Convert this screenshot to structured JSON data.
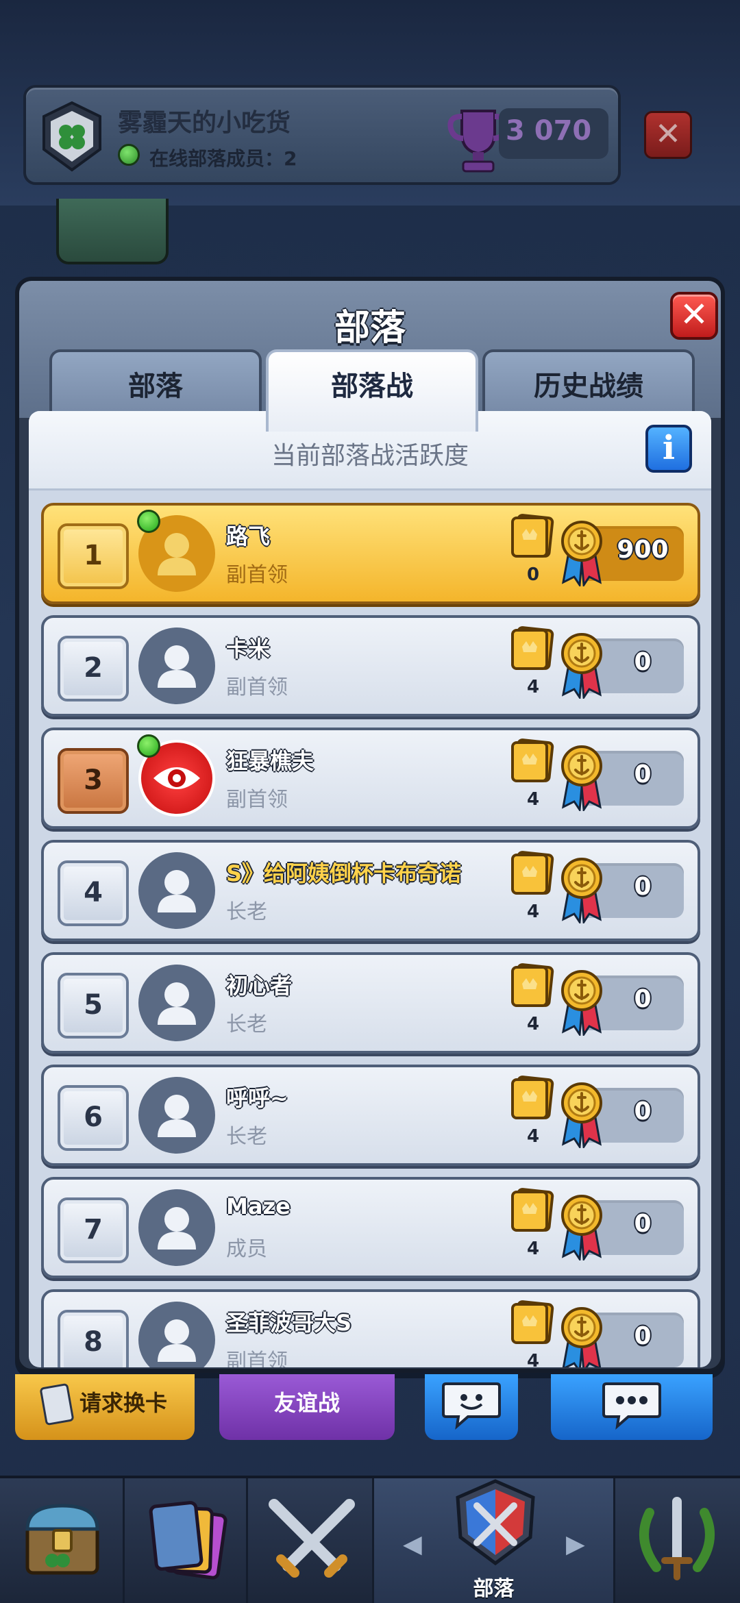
{
  "clan": {
    "name": "雾霾天的小吃货",
    "online_label": "在线部落成员：2",
    "trophies": "3 070"
  },
  "panel": {
    "title": "部落",
    "tabs": [
      {
        "label": "部落",
        "active": false
      },
      {
        "label": "部落战",
        "active": true
      },
      {
        "label": "历史战绩",
        "active": false
      }
    ],
    "activity_title": "当前部落战活跃度",
    "info_label": "i"
  },
  "members": [
    {
      "rank": "1",
      "name": "路飞",
      "role": "副首领",
      "cards": "0",
      "score": "900",
      "online": true,
      "avatar": "gold-silhouette"
    },
    {
      "rank": "2",
      "name": "卡米",
      "role": "副首领",
      "cards": "4",
      "score": "0",
      "online": false,
      "avatar": "silhouette"
    },
    {
      "rank": "3",
      "name": "狂暴樵夫",
      "role": "副首领",
      "cards": "4",
      "score": "0",
      "online": true,
      "avatar": "eye-emblem"
    },
    {
      "rank": "4",
      "name": "S》给阿姨倒杯卡布奇诺",
      "role": "长老",
      "cards": "4",
      "score": "0",
      "online": false,
      "avatar": "silhouette"
    },
    {
      "rank": "5",
      "name": "初心者",
      "role": "长老",
      "cards": "4",
      "score": "0",
      "online": false,
      "avatar": "silhouette"
    },
    {
      "rank": "6",
      "name": "呼呼~",
      "role": "长老",
      "cards": "4",
      "score": "0",
      "online": false,
      "avatar": "silhouette"
    },
    {
      "rank": "7",
      "name": "Maze",
      "role": "成员",
      "cards": "4",
      "score": "0",
      "online": false,
      "avatar": "silhouette"
    },
    {
      "rank": "8",
      "name": "圣菲波哥大S",
      "role": "副首领",
      "cards": "4",
      "score": "0",
      "online": false,
      "avatar": "silhouette"
    }
  ],
  "actions": {
    "request_cards": "请求换卡",
    "friendly_battle": "友谊战"
  },
  "nav": {
    "clan_label": "部落"
  },
  "colors": {
    "gold_row": "#f4b52b",
    "online_green": "#23a71a",
    "close_red": "#c01c1c",
    "info_blue": "#1f6fe0"
  }
}
